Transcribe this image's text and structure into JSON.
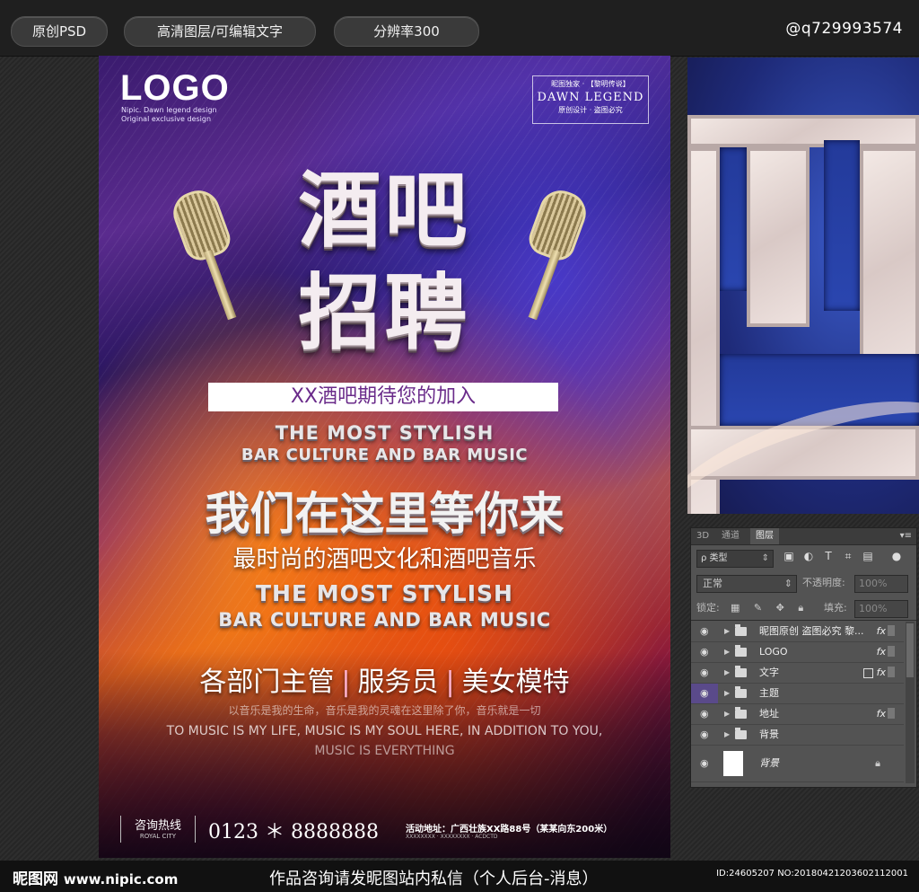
{
  "topbar": {
    "pills": [
      "原创PSD",
      "高清图层/可编辑文字",
      "分辨率300"
    ],
    "handle": "@q729993574"
  },
  "poster": {
    "logo": "LOGO",
    "logo_sub": [
      "Nipic. Dawn legend design",
      "Original exclusive design"
    ],
    "badge": {
      "top": "昵图独家 · 【黎明传说】",
      "brand": "DAWN LEGEND",
      "bottom": "原创设计 · 盗图必究"
    },
    "title_line1": "酒吧",
    "title_line2": "招聘",
    "banner": "XX酒吧期待您的加入",
    "en_line1": "THE MOST STYLISH",
    "en_line2": "BAR CULTURE AND BAR MUSIC",
    "zh_headline": "我们在这里等你来",
    "zh_sub": "最时尚的酒吧文化和酒吧音乐",
    "en_line3": "THE MOST STYLISH",
    "en_line4": "BAR CULTURE AND BAR MUSIC",
    "roles": [
      "各部门主管",
      "服务员",
      "美女模特"
    ],
    "small_zh": "以音乐是我的生命，音乐是我的灵魂在这里除了你，音乐就是一切",
    "small_en1": "TO MUSIC IS MY LIFE, MUSIC IS MY SOUL HERE, IN ADDITION TO YOU,",
    "small_en2": "MUSIC IS EVERYTHING",
    "hotline_label": "咨询热线",
    "hotline_sub": "ROYAL CITY",
    "phone": "0123 ＊ 8888888",
    "address": "活动地址：广西壮族XX路88号（某某向东200米）",
    "address_sub": "XXXXXXXX · XXXXXXXX · ACDCTD"
  },
  "layers_panel": {
    "tabs": [
      "3D",
      "通道",
      "图层"
    ],
    "active_tab": "图层",
    "filter_kind": "类型",
    "blend_mode": "正常",
    "opacity_label": "不透明度:",
    "opacity_value": "100%",
    "lock_label": "锁定:",
    "fill_label": "填充:",
    "fill_value": "100%",
    "layers": [
      {
        "name": "昵图原创 盗图必究  黎...",
        "fx": "fx"
      },
      {
        "name": "LOGO",
        "fx": "fx"
      },
      {
        "name": "文字",
        "fx": "fx"
      },
      {
        "name": "主题",
        "fx": ""
      },
      {
        "name": "地址",
        "fx": "fx"
      },
      {
        "name": "背景",
        "fx": ""
      }
    ],
    "background_layer": "背景"
  },
  "bottombar": {
    "brand": "昵图网",
    "url": "www.nipic.com",
    "notice": "作品咨询请发昵图站内私信（个人后台-消息）",
    "id": "ID:24605207 NO:20180421203602112001"
  }
}
